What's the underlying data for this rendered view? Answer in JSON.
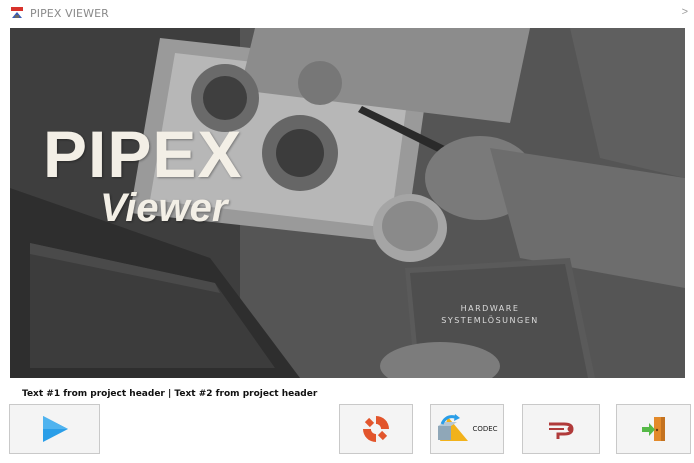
{
  "window": {
    "title": "PIPEX VIEWER",
    "chevron": ">"
  },
  "hero": {
    "brand": "PIPEX",
    "subtitle": "Viewer",
    "background": "grayscale desk photo",
    "book_line1": "HARDWARE",
    "book_line2": "SYSTEMLÖSUNGEN"
  },
  "project_header": {
    "text": "Text #1 from project header | Text #2 from project header"
  },
  "buttons": {
    "play": {
      "icon": "play-icon"
    },
    "help": {
      "icon": "lifebuoy-icon"
    },
    "codec": {
      "icon": "codec-icon",
      "label": "CODEC"
    },
    "pipe": {
      "icon": "pipe-icon"
    },
    "exit": {
      "icon": "exit-door-icon"
    }
  },
  "colors": {
    "brand_text": "#f3efe6",
    "play_blue": "#2a9ee8",
    "lifebuoy_red": "#e2552c",
    "pipe_red": "#b03a3a",
    "exit_green": "#55b947",
    "exit_orange": "#e38a2a"
  }
}
